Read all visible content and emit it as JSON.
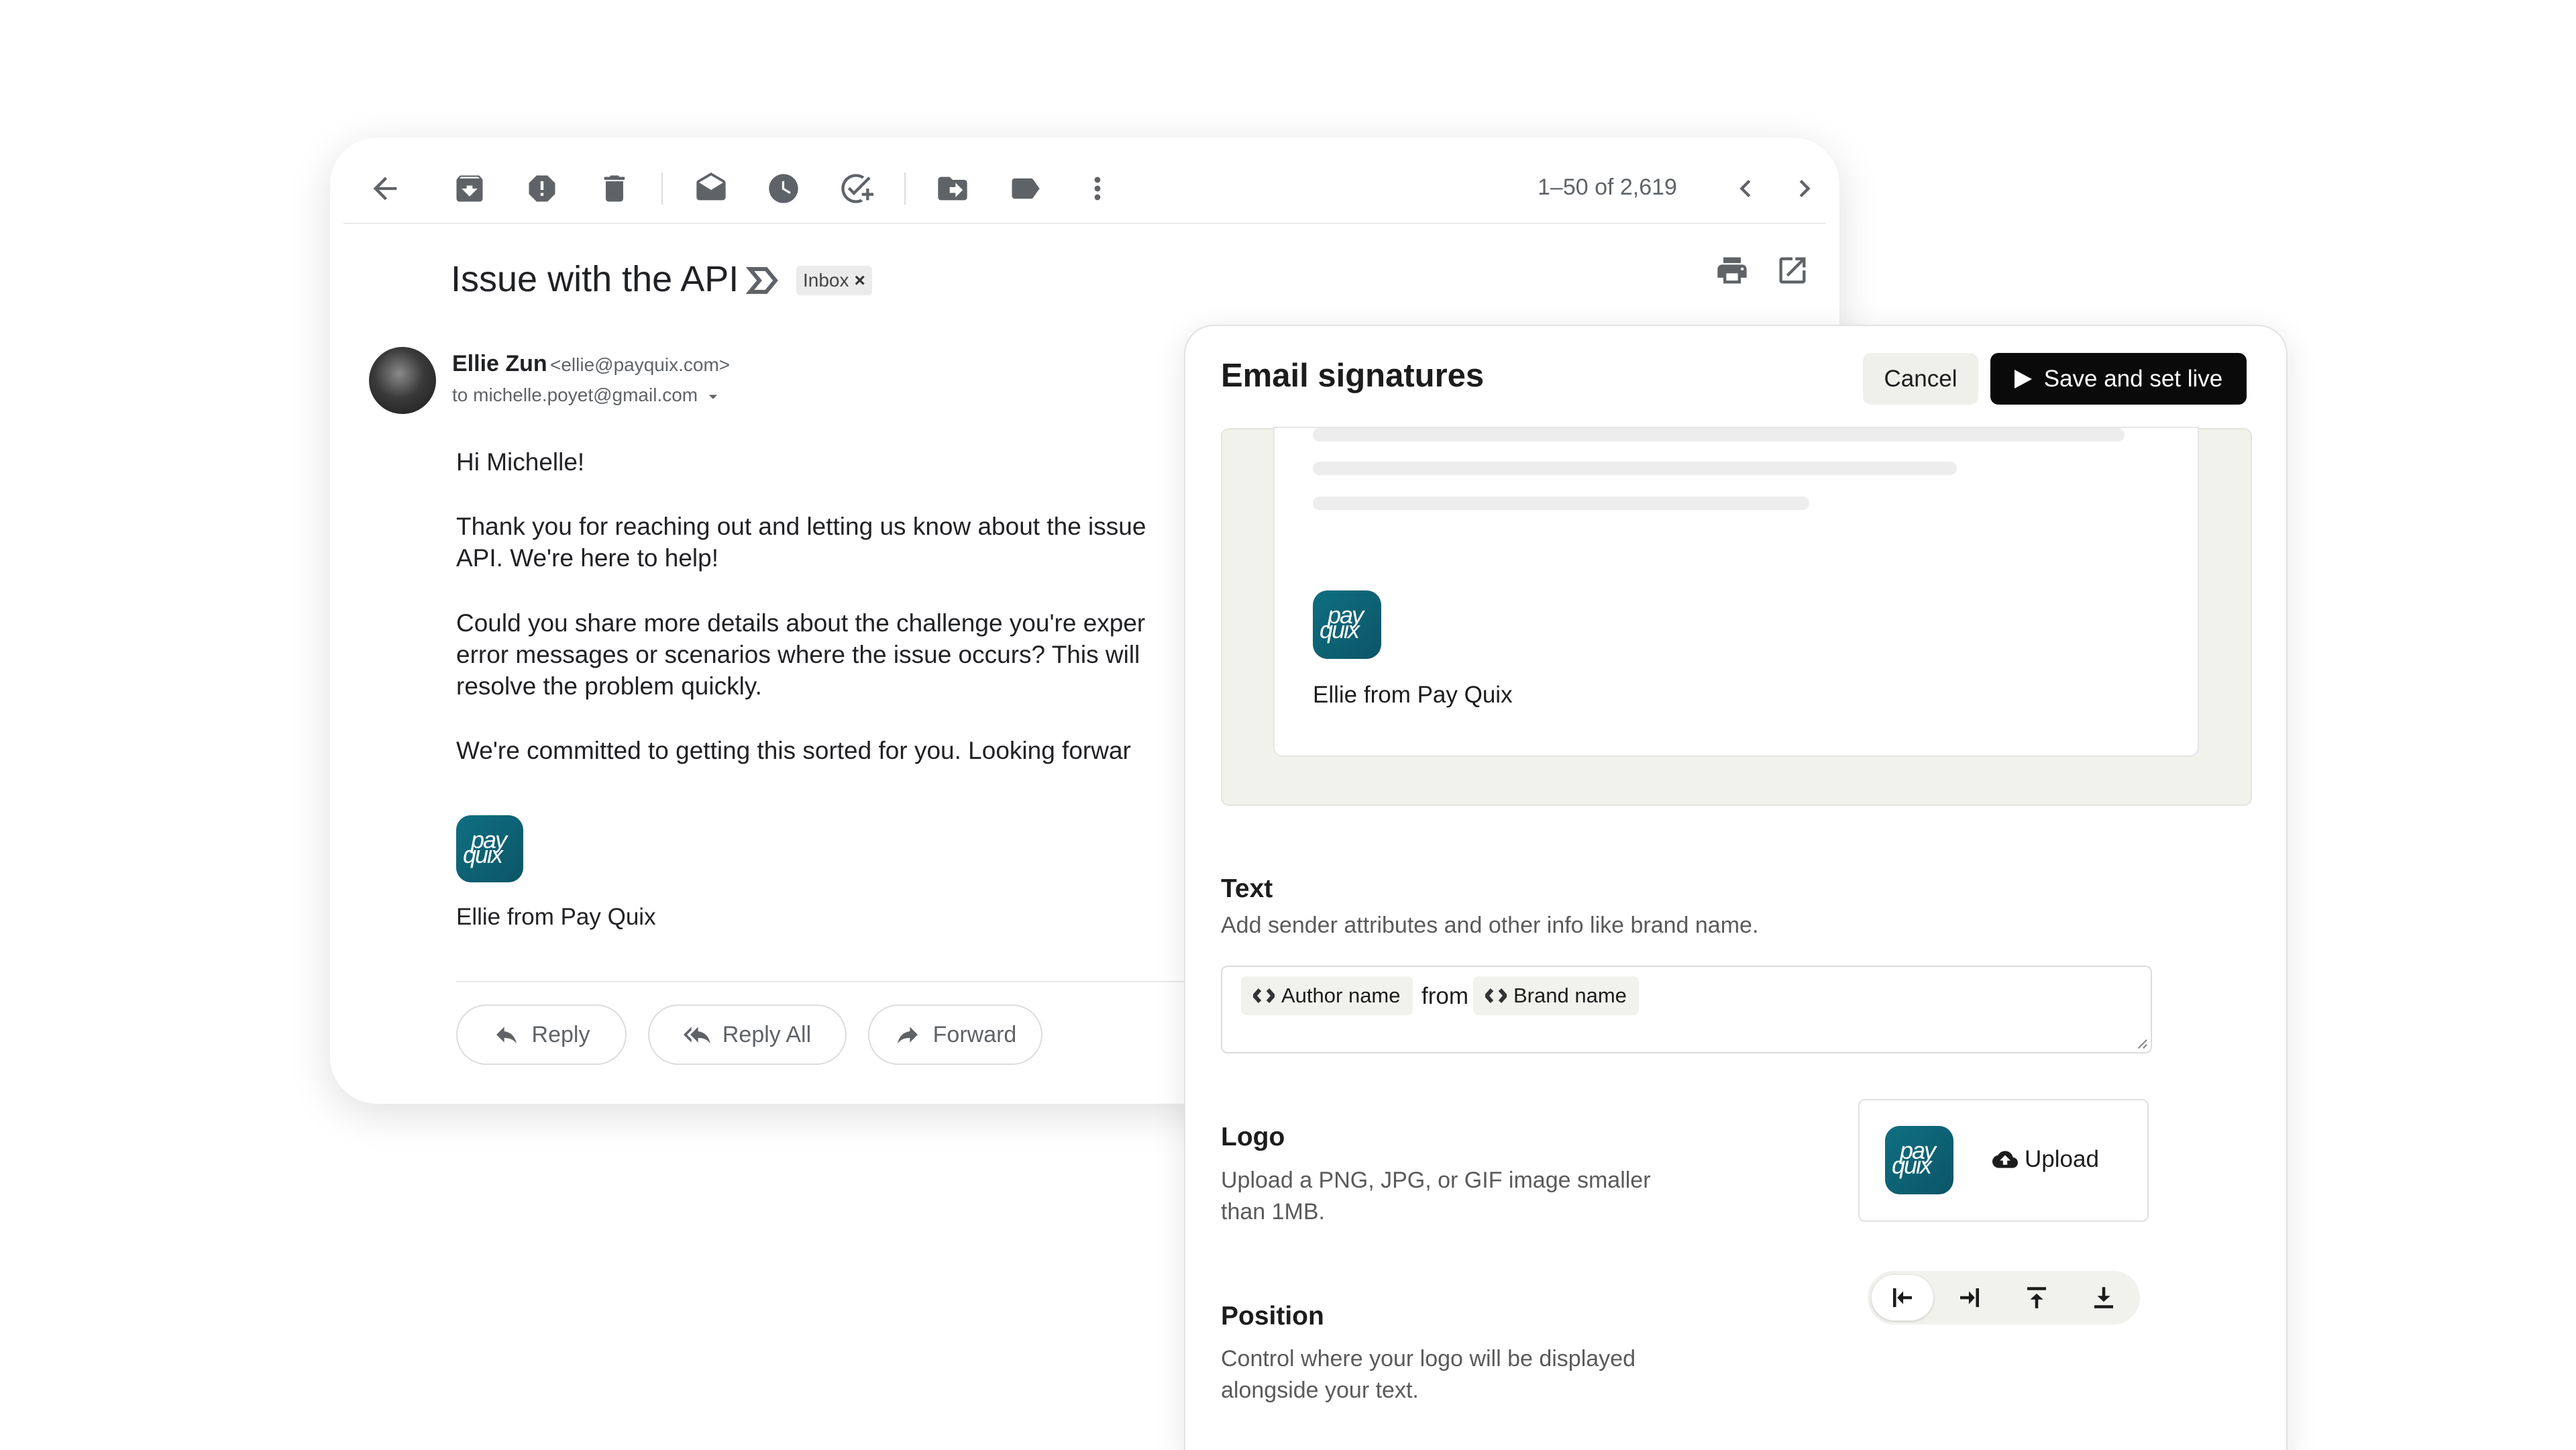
{
  "mail": {
    "page_count": "1–50 of 2,619",
    "subject": "Issue with the API",
    "label_chip": "Inbox",
    "chip_close": "×",
    "sender": {
      "name": "Ellie Zun",
      "email": "<ellie@payquix.com>",
      "to": "to michelle.poyet@gmail.com"
    },
    "body": {
      "greeting": "Hi Michelle!",
      "p1_line1": "Thank you for reaching out and letting us know about the issue",
      "p1_line2": "API. We're here to help!",
      "p2_line1": "Could you share more details about the challenge you're exper",
      "p2_line2": "error messages or scenarios where the issue occurs? This will",
      "p2_line3": "resolve the problem quickly.",
      "p3_line1": "We're committed to getting this sorted for you. Looking forwar"
    },
    "signature_name": "Ellie from Pay Quix",
    "actions": {
      "reply": "Reply",
      "reply_all": "Reply All",
      "forward": "Forward"
    }
  },
  "logo": {
    "top": "pay",
    "bottom": "quix",
    "accent_letter": "y"
  },
  "signatures": {
    "title": "Email signatures",
    "cancel": "Cancel",
    "save": "Save and set live",
    "preview_name": "Ellie from Pay Quix",
    "text_section": {
      "title": "Text",
      "description": "Add sender attributes and other info like brand name.",
      "token_author": "Author name",
      "token_joiner": "from",
      "token_brand": "Brand name"
    },
    "logo_section": {
      "title": "Logo",
      "description_line1": "Upload a PNG, JPG, or GIF image smaller",
      "description_line2": "than 1MB.",
      "upload": "Upload"
    },
    "position_section": {
      "title": "Position",
      "description_line1": "Control where your logo will be displayed",
      "description_line2": "alongside your text."
    }
  },
  "colors": {
    "brand_teal": "#0f6f82",
    "primary_button": "#0a0a0a",
    "preview_bg": "#f2f2ec"
  }
}
